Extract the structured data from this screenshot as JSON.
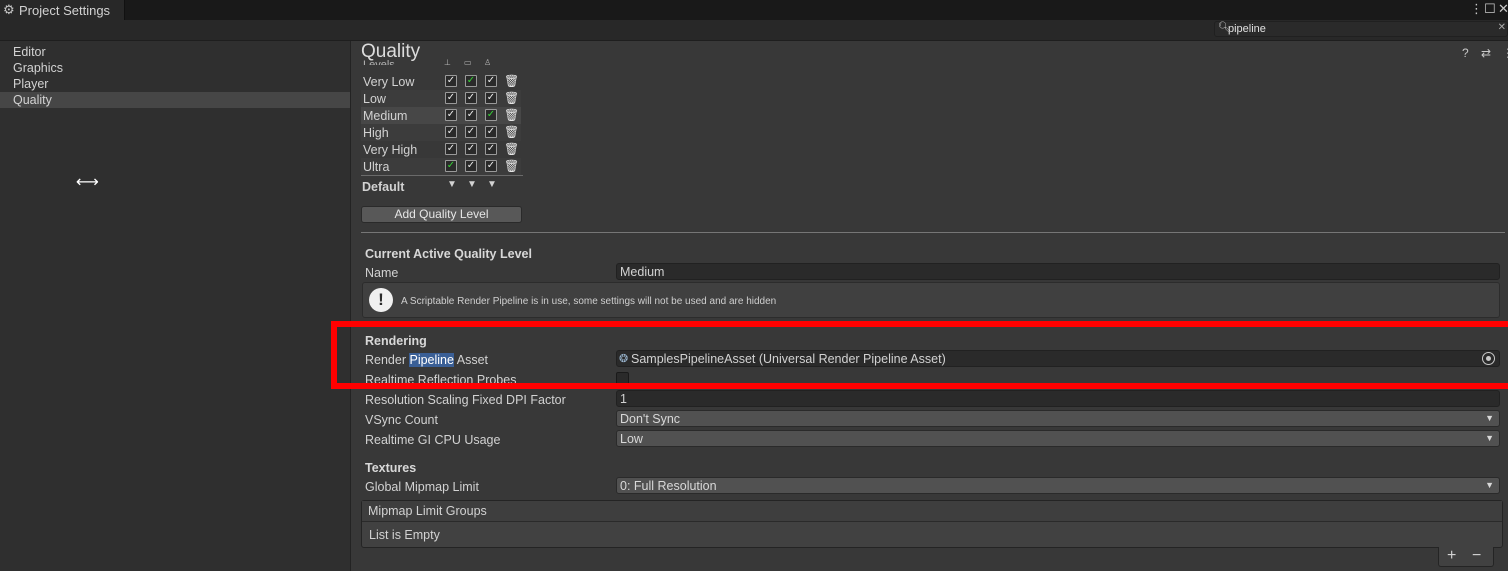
{
  "window": {
    "tab_title": "Project Settings",
    "more_glyph": "⋮",
    "maximize_glyph": "☐",
    "close_glyph": "✕"
  },
  "search": {
    "value": "pipeline",
    "clear_glyph": "✕"
  },
  "sidebar": {
    "items": [
      {
        "label": "Editor",
        "selected": false
      },
      {
        "label": "Graphics",
        "selected": false
      },
      {
        "label": "Player",
        "selected": false
      },
      {
        "label": "Quality",
        "selected": true
      }
    ]
  },
  "page": {
    "title": "Quality",
    "help_glyph": "?",
    "presets_glyph": "⇄",
    "menu_glyph": "⋮"
  },
  "levels": {
    "header": "Levels",
    "rows": [
      {
        "name": "Very Low",
        "platforms": [
          true,
          true,
          true
        ],
        "default_platform": 1
      },
      {
        "name": "Low",
        "platforms": [
          true,
          true,
          true
        ],
        "default_platform": -1
      },
      {
        "name": "Medium",
        "platforms": [
          true,
          true,
          true
        ],
        "default_platform": 2
      },
      {
        "name": "High",
        "platforms": [
          true,
          true,
          true
        ],
        "default_platform": -1
      },
      {
        "name": "Very High",
        "platforms": [
          true,
          true,
          true
        ],
        "default_platform": -1
      },
      {
        "name": "Ultra",
        "platforms": [
          true,
          true,
          true
        ],
        "default_platform": 0
      }
    ],
    "default_label": "Default",
    "add_button": "Add Quality Level"
  },
  "current": {
    "section": "Current Active Quality Level",
    "name_label": "Name",
    "name_value": "Medium",
    "info": "A Scriptable Render Pipeline is in use, some settings will not be used and are hidden"
  },
  "rendering": {
    "section": "Rendering",
    "rpa_label_before": "Render ",
    "rpa_label_highlight": "Pipeline",
    "rpa_label_after": " Asset",
    "rpa_value": "SamplesPipelineAsset (Universal Render Pipeline Asset)",
    "rrp_label": "Realtime Reflection Probes",
    "rrp_value": false,
    "dpi_label": "Resolution Scaling Fixed DPI Factor",
    "dpi_value": "1",
    "vsync_label": "VSync Count",
    "vsync_value": "Don't Sync",
    "gi_label": "Realtime GI CPU Usage",
    "gi_value": "Low"
  },
  "textures": {
    "section": "Textures",
    "mip_label": "Global Mipmap Limit",
    "mip_value": "0: Full Resolution",
    "groups_header": "Mipmap Limit Groups",
    "groups_empty": "List is Empty",
    "add_glyph": "+",
    "remove_glyph": "−"
  },
  "colors": {
    "highlight": "#3a5f96",
    "annotation_box": "#ff0000",
    "default_check": "#36d236"
  }
}
